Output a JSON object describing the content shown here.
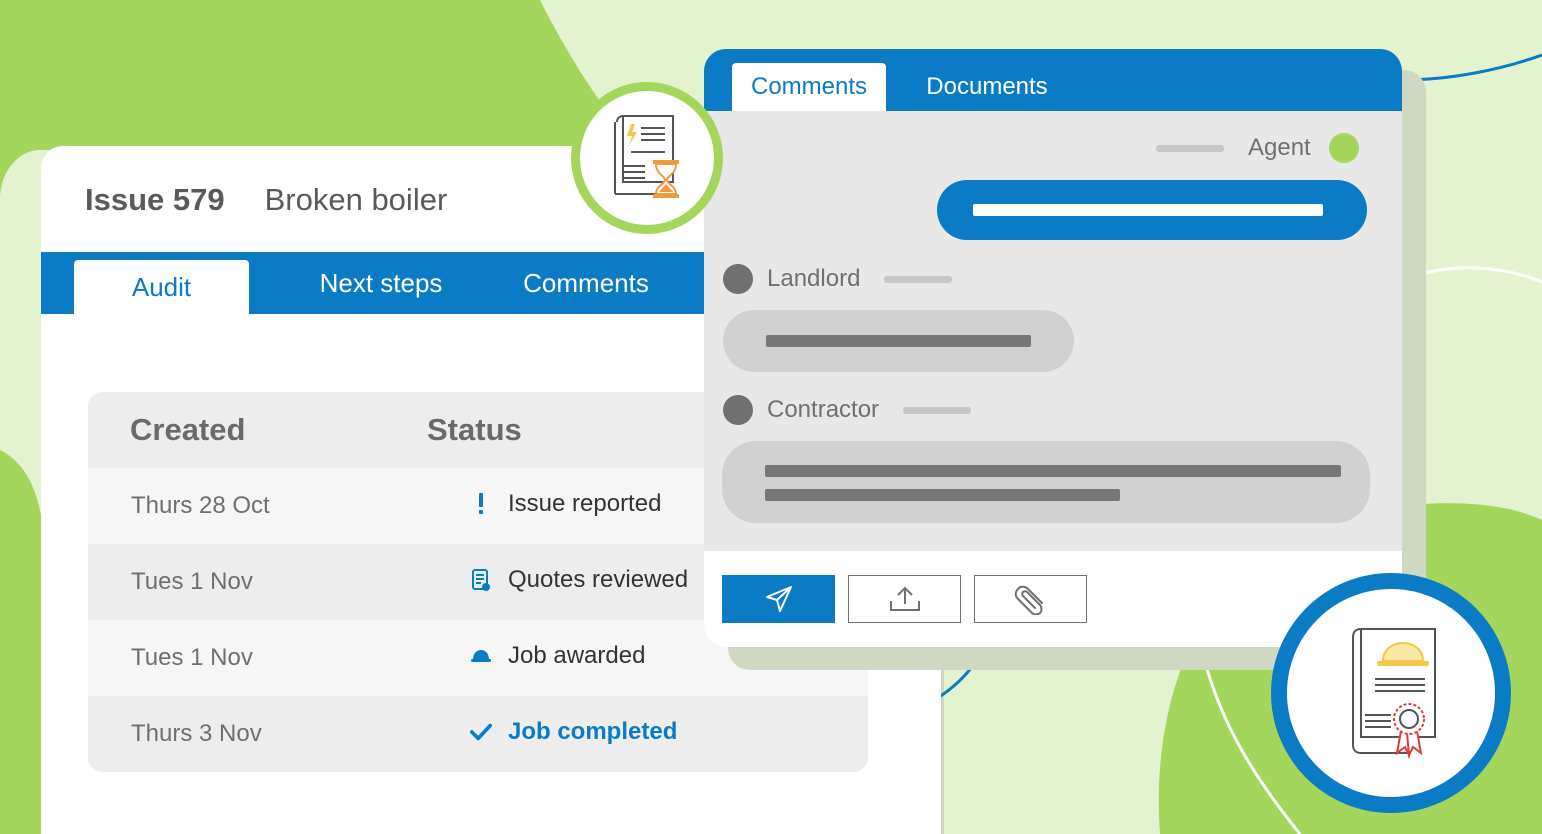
{
  "issue": {
    "number": "Issue 579",
    "title": "Broken boiler",
    "tabs": [
      {
        "label": "Audit"
      },
      {
        "label": "Next steps"
      },
      {
        "label": "Comments"
      }
    ]
  },
  "audit_table": {
    "headers": {
      "created": "Created",
      "status": "Status"
    },
    "rows": [
      {
        "date": "Thurs 28 Oct",
        "status": "Issue reported",
        "icon": "exclamation-icon"
      },
      {
        "date": "Tues 1 Nov",
        "status": "Quotes reviewed",
        "icon": "clipboard-icon"
      },
      {
        "date": "Tues 1 Nov",
        "status": "Job awarded",
        "icon": "hard-hat-icon"
      },
      {
        "date": "Thurs 3 Nov",
        "status": "Job completed",
        "icon": "checkmark-icon"
      }
    ]
  },
  "comments_panel": {
    "tabs": [
      {
        "label": "Comments"
      },
      {
        "label": "Documents"
      }
    ],
    "messages": [
      {
        "sender": "Agent"
      },
      {
        "sender": "Landlord"
      },
      {
        "sender": "Contractor"
      }
    ],
    "actions": {
      "send_icon": "send-icon",
      "upload_icon": "upload-icon",
      "attach_icon": "paperclip-icon"
    }
  },
  "badges": {
    "top_icon": "document-hourglass-icon",
    "bottom_icon": "certificate-hard-hat-icon"
  },
  "colors": {
    "primary_blue": "#0c7bc5",
    "accent_green": "#a4d65e",
    "agent_dot": "#a4d65e",
    "participant_dot": "#707070",
    "icon_orange": "#f29a3e",
    "icon_yellow": "#f2c94c"
  }
}
